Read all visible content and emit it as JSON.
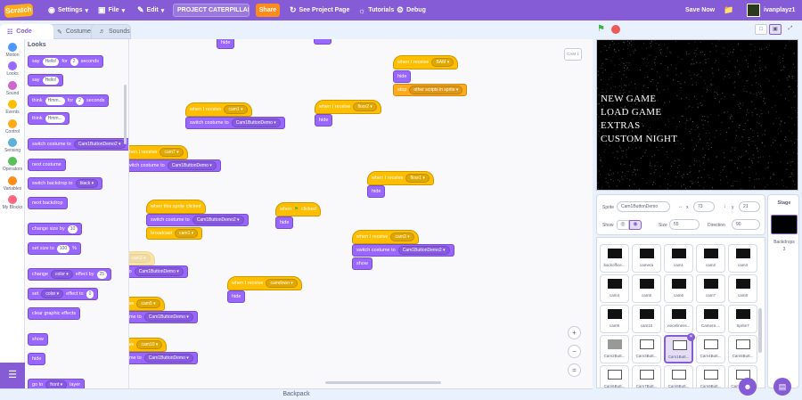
{
  "menubar": {
    "logo": "Scratch",
    "settings": "Settings",
    "file": "File",
    "edit": "Edit",
    "project_title": "PROJECT CATERPILLAR (...",
    "share": "Share",
    "see_project": "See Project Page",
    "tutorials": "Tutorials",
    "debug": "Debug",
    "save_now": "Save Now",
    "username": "ivanplayz1"
  },
  "tabs": {
    "code": "Code",
    "costumes": "Costumes",
    "sounds": "Sounds"
  },
  "categories": [
    {
      "label": "Motion",
      "color": "#4c97ff"
    },
    {
      "label": "Looks",
      "color": "#9966ff"
    },
    {
      "label": "Sound",
      "color": "#cf63cf"
    },
    {
      "label": "Events",
      "color": "#ffbf00"
    },
    {
      "label": "Control",
      "color": "#ffab19"
    },
    {
      "label": "Sensing",
      "color": "#5cb1d6"
    },
    {
      "label": "Operators",
      "color": "#59c059"
    },
    {
      "label": "Variables",
      "color": "#ff8c1a"
    },
    {
      "label": "My Blocks",
      "color": "#ff6680"
    }
  ],
  "palette": {
    "title": "Looks",
    "say_for": {
      "say": "say",
      "msg": "Hello!",
      "for": "for",
      "secs": "2",
      "seconds": "seconds"
    },
    "say": {
      "say": "say",
      "msg": "Hello!"
    },
    "think_for": {
      "think": "think",
      "msg": "Hmm...",
      "for": "for",
      "secs": "2",
      "seconds": "seconds"
    },
    "think": {
      "think": "think",
      "msg": "Hmm..."
    },
    "switch_costume": {
      "label": "switch costume to",
      "value": "Cam1ButtonDemo2"
    },
    "next_costume": "next costume",
    "switch_backdrop": {
      "label": "switch backdrop to",
      "value": "black"
    },
    "next_backdrop": "next backdrop",
    "change_size": {
      "label": "change size by",
      "value": "10"
    },
    "set_size": {
      "label": "set size to",
      "value": "100",
      "unit": "%"
    },
    "change_effect": {
      "change": "change",
      "effect": "color",
      "by": "effect by",
      "value": "25"
    },
    "set_effect": {
      "set": "set",
      "effect": "color",
      "to": "effect to",
      "value": "0"
    },
    "clear_effects": "clear graphic effects",
    "show": "show",
    "hide": "hide",
    "go_to_layer": {
      "label": "go to",
      "value": "front",
      "layer": "layer"
    }
  },
  "scripts": {
    "when_receive": "when I receive",
    "switch_costume": "switch costume to",
    "hide": "hide",
    "show": "show",
    "stop": "stop",
    "other_scripts": "other scripts in sprite",
    "when_clicked": "when",
    "clicked": "clicked",
    "sprite_clicked": "when this sprite clicked",
    "broadcast": "broadcast",
    "msg_bam": "BAM",
    "msg_cam1": "cam1",
    "msg_cam7": "cam7",
    "msg_camdown": "camdown",
    "msg_cam3": "cam3",
    "msg_cam5": "cam5",
    "msg_cam10": "cam10",
    "msg_floor1": "floor1",
    "msg_floor2": "floor2",
    "costume_demo": "Cam1ButtonDemo",
    "costume_demo2": "Cam1ButtonDemo2"
  },
  "stage": {
    "sprite_label": "CAM 1",
    "menu": [
      "NEW GAME",
      "LOAD GAME",
      "EXTRAS",
      "CUSTOM NIGHT"
    ],
    "background": "#000000"
  },
  "sprite_info": {
    "sprite_label": "Sprite",
    "sprite_name": "Cam1ButtonDemo",
    "x": "73",
    "y": "21",
    "show_label": "Show",
    "size_label": "Size",
    "size": "55",
    "direction_label": "Direction",
    "direction": "90"
  },
  "sprites": [
    "backoffice...",
    "camera",
    "cam1",
    "cam2",
    "cam3",
    "cam4",
    "cam5",
    "cam6",
    "cam7",
    "cam8",
    "cam9",
    "cam10",
    "voiceliness...",
    "Camera ...",
    "Sprite7",
    "Cam2Butt...",
    "Cam3Butt...",
    "Cam1Butt...",
    "Cam4Butt...",
    "Cam5Butt...",
    "Cam6Butt...",
    "Cam7Butt...",
    "Cam8Butt...",
    "Cam9Butt...",
    "Cam10Butt..."
  ],
  "stage_panel": {
    "title": "Stage",
    "backdrops_label": "Backdrops",
    "backdrops_count": "3"
  },
  "backpack": "Backpack",
  "accent": "#855cd6"
}
